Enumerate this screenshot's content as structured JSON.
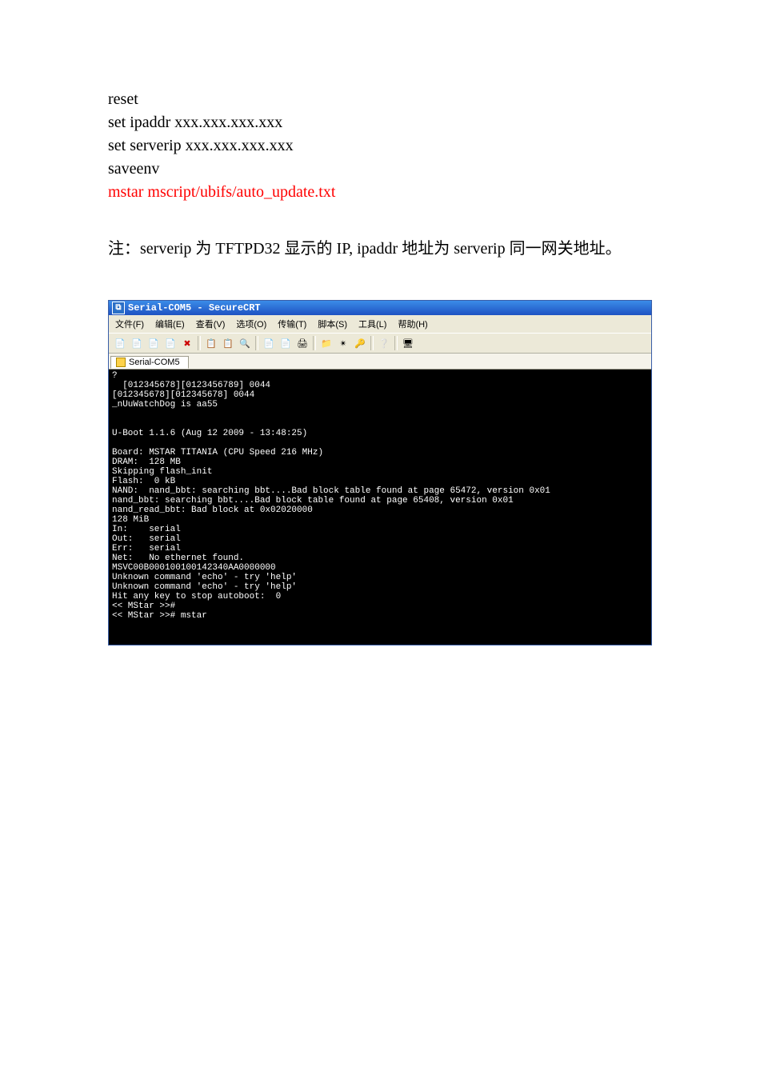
{
  "commands": {
    "l1": "reset",
    "l2": "set ipaddr xxx.xxx.xxx.xxx",
    "l3": "set serverip xxx.xxx.xxx.xxx",
    "l4": "saveenv",
    "l5": "mstar mscript/ubifs/auto_update.txt"
  },
  "note": "注：serverip 为 TFTPD32 显示的 IP, ipaddr 地址为 serverip 同一网关地址。",
  "crt": {
    "title": "Serial-COM5 - SecureCRT",
    "menu": {
      "file": "文件(F)",
      "edit": "编辑(E)",
      "view": "查看(V)",
      "option": "选项(O)",
      "xfer": "传输(T)",
      "script": "脚本(S)",
      "tool": "工具(L)",
      "help": "帮助(H)"
    },
    "tab": "Serial-COM5",
    "terminal": "?\n  [012345678][0123456789] 0044\n[012345678][012345678] 0044\n_nUuWatchDog is aa55\n\n\nU-Boot 1.1.6 (Aug 12 2009 - 13:48:25)\n\nBoard: MSTAR TITANIA (CPU Speed 216 MHz)\nDRAM:  128 MB\nSkipping flash_init\nFlash:  0 kB\nNAND:  nand_bbt: searching bbt....Bad block table found at page 65472, version 0x01\nnand_bbt: searching bbt....Bad block table found at page 65408, version 0x01\nnand_read_bbt: Bad block at 0x02020000\n128 MiB\nIn:    serial\nOut:   serial\nErr:   serial\nNet:   No ethernet found.\nMSVC00B000100100142340AA0000000\nUnknown command 'echo' - try 'help'\nUnknown command 'echo' - try 'help'\nHit any key to stop autoboot:  0\n<< MStar >>#\n<< MStar >># mstar"
  },
  "icons": {
    "i1": "📄",
    "i2": "📄",
    "i3": "📄",
    "i4": "📄",
    "i5": "✖",
    "i6": "📋",
    "i7": "📋",
    "i8": "🔍",
    "i9": "📄",
    "i10": "📄",
    "i11": "🖨",
    "i12": "📁",
    "i13": "✴",
    "i14": "🔑",
    "i15": "❔",
    "i16": "🖥"
  }
}
